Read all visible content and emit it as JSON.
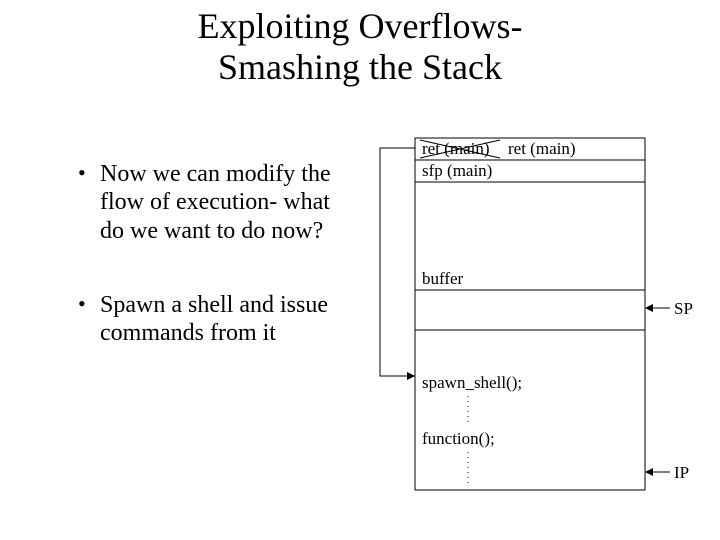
{
  "title_line1": "Exploiting Overflows-",
  "title_line2": "Smashing the Stack",
  "bullets": {
    "b1": "Now we can modify the flow of execution- what do we want to do now?",
    "b2": "Spawn a shell and issue commands from it"
  },
  "diagram": {
    "ret_main_struck": "ret (main)",
    "ret_main_new": "ret (main)",
    "sfp_main": "sfp (main)",
    "buffer": "buffer",
    "spawn_shell": "spawn_shell();",
    "function_call": "function();",
    "sp_label": "SP",
    "ip_label": "IP"
  }
}
